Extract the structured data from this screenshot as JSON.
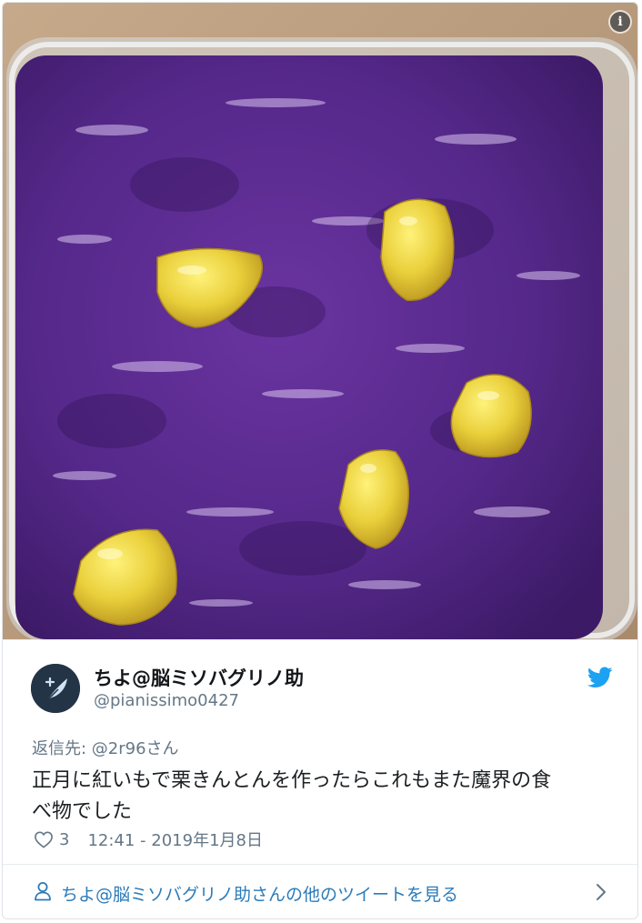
{
  "tweet": {
    "display_name": "ちよ@脳ミソバグリノ助",
    "handle": "@pianissimo0427",
    "reply_prefix": "返信先: ",
    "reply_mention": "@2r96さん",
    "text_line1": "正月に紅いもで栗きんとんを作ったらこれもまた魔界の食",
    "text_line2": "べ物でした",
    "likes": "3",
    "timestamp": "12:41 - 2019年1月8日"
  },
  "footer": {
    "more_tweets_label": "ちよ@脳ミソバグリノ助さんの他のツイートを見る"
  },
  "media": {
    "info_icon_label": "i"
  },
  "icons": {
    "info": "info-icon",
    "bird": "twitter-bird-icon",
    "heart": "heart-icon",
    "person": "person-icon",
    "chevron": "chevron-right-icon"
  },
  "colors": {
    "twitter_blue": "#1da1f2",
    "link_blue": "#2b7bb9",
    "secondary_text": "#657786",
    "primary_text": "#1c2022",
    "purple_paste": "#5a2a86",
    "chestnut_yellow": "#e8d23e"
  }
}
